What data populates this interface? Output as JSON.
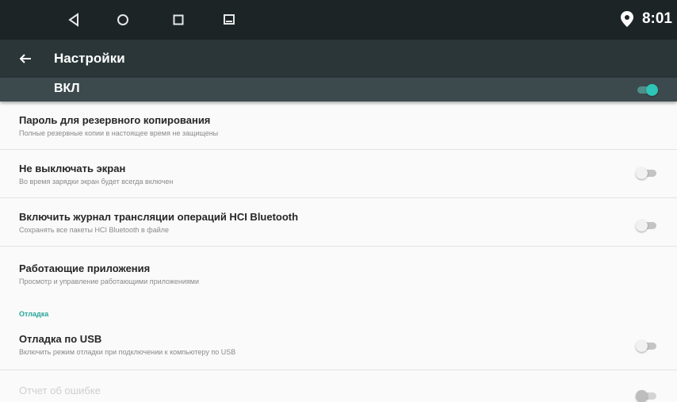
{
  "status_bar": {
    "time": "8:01",
    "icons": [
      "back-triangle-icon",
      "home-circle-icon",
      "recents-square-icon",
      "screenshot-icon",
      "location-icon"
    ]
  },
  "toolbar": {
    "title": "Настройки",
    "back_icon": "arrow-left-icon"
  },
  "master_switch": {
    "label": "ВКЛ",
    "state": "on"
  },
  "items": [
    {
      "title": "Пароль для резервного копирования",
      "subtitle": "Полные резервные копии в настоящее время не защищены",
      "toggle": null
    },
    {
      "title": "Не выключать экран",
      "subtitle": "Во время зарядки экран будет всегда включен",
      "toggle": "off"
    },
    {
      "title": "Включить журнал трансляции операций HCI Bluetooth",
      "subtitle": "Сохранять все пакеты HCI Bluetooth в файле",
      "toggle": "off"
    },
    {
      "title": "Работающие приложения",
      "subtitle": "Просмотр и управление работающими приложениями",
      "toggle": null
    }
  ],
  "category": "Отладка",
  "debug_items": [
    {
      "title": "Отладка по USB",
      "subtitle": "Включить режим отладки при подключении к компьютеру по USB",
      "toggle": "off"
    },
    {
      "title": "Отчет об ошибке",
      "subtitle": "",
      "toggle": "off",
      "disabled": true
    }
  ],
  "colors": {
    "status_bar": "#1c2426",
    "toolbar": "#2a3638",
    "master_bar": "#3c4a4e",
    "accent": "#26a69a",
    "switch_on": "#2ec4b6"
  }
}
